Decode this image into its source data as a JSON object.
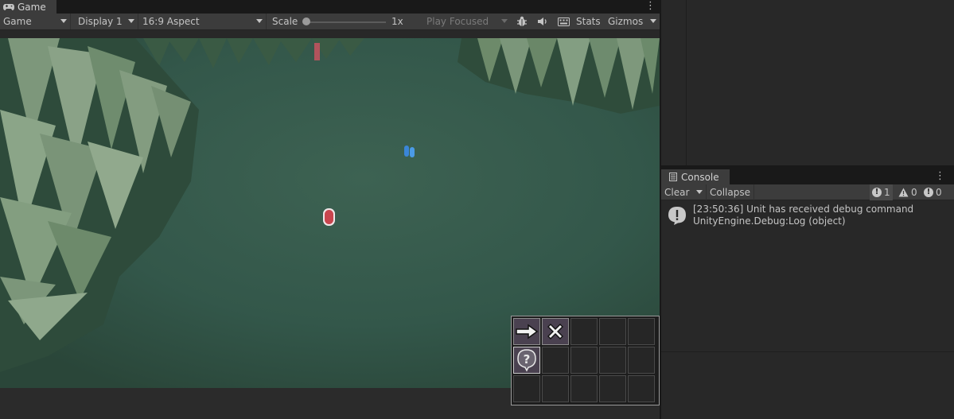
{
  "game_window": {
    "tab_title": "Game",
    "toolbar": {
      "view_select": "Game",
      "display_select": "Display 1",
      "aspect_select": "16:9 Aspect",
      "scale_label": "Scale",
      "scale_value": "1x",
      "play_mode_select": "Play Focused",
      "stats_label": "Stats",
      "gizmos_label": "Gizmos"
    },
    "scene": {
      "colors": {
        "ground": "#345747",
        "tree": "#5b7a5c",
        "unit_red": "#c8454e",
        "unit_blue": "#3a86d8"
      }
    },
    "action_bar": {
      "slots": [
        {
          "icon": "move-arrow-icon",
          "active": true
        },
        {
          "icon": "stop-x-icon",
          "active": true
        },
        {
          "icon": "",
          "active": false
        },
        {
          "icon": "",
          "active": false
        },
        {
          "icon": "",
          "active": false
        },
        {
          "icon": "help-question-icon",
          "active": true
        },
        {
          "icon": "",
          "active": false
        },
        {
          "icon": "",
          "active": false
        },
        {
          "icon": "",
          "active": false
        },
        {
          "icon": "",
          "active": false
        },
        {
          "icon": "",
          "active": false
        },
        {
          "icon": "",
          "active": false
        },
        {
          "icon": "",
          "active": false
        },
        {
          "icon": "",
          "active": false
        },
        {
          "icon": "",
          "active": false
        }
      ]
    }
  },
  "console": {
    "tab_title": "Console",
    "toolbar": {
      "clear_label": "Clear",
      "collapse_label": "Collapse",
      "info_count": "1",
      "warning_count": "0",
      "error_count": "0"
    },
    "entries": [
      {
        "type": "info",
        "line1": "[23:50:36] Unit has received debug command",
        "line2": "UnityEngine.Debug:Log (object)"
      }
    ]
  }
}
